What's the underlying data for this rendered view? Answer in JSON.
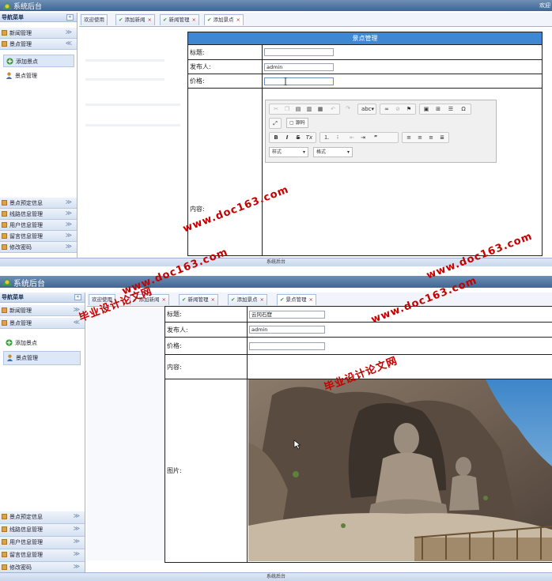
{
  "app": {
    "title": "系统后台",
    "corner_text": "欢迎"
  },
  "sidebar": {
    "header": "导航菜单",
    "collapse_glyph": "«",
    "expand_glyph": "»",
    "top_groups": [
      {
        "label": "新闻管理"
      },
      {
        "label": "景点管理"
      }
    ],
    "sub_items": [
      {
        "label": "添加景点"
      },
      {
        "label": "景点管理"
      }
    ],
    "bottom_groups": [
      {
        "label": "景点预定信息"
      },
      {
        "label": "线路信息管理"
      },
      {
        "label": "用户信息管理"
      },
      {
        "label": "留言信息管理"
      },
      {
        "label": "修改密码"
      }
    ]
  },
  "screen1": {
    "tabs": [
      {
        "label": "欢迎使用"
      },
      {
        "label": "添加新闻"
      },
      {
        "label": "新闻管理"
      },
      {
        "label": "添加景点"
      }
    ],
    "form": {
      "heading": "景点管理",
      "title_label": "标题:",
      "publisher_label": "发布人:",
      "publisher_value": "admin",
      "price_label": "价格:",
      "content_label": "内容:"
    },
    "editor": {
      "source_button": "源码",
      "style_combo": "样式",
      "format_combo": "格式"
    },
    "footer": "系统后台"
  },
  "screen2": {
    "tabs": [
      {
        "label": "欢迎使用"
      },
      {
        "label": "添加新闻"
      },
      {
        "label": "新闻管理"
      },
      {
        "label": "添加景点"
      },
      {
        "label": "景点管理"
      }
    ],
    "form": {
      "title_label": "标题:",
      "title_value": "云冈石窟",
      "publisher_label": "发布人:",
      "publisher_value": "admin",
      "price_label": "价格:",
      "content_label": "内容:",
      "image_label": "图片:"
    },
    "footer": "系统后台"
  },
  "watermark": {
    "cn": "毕业设计论文网",
    "url": "www.doc163.com"
  },
  "colors": {
    "header": "#3f6694",
    "form_title": "#3f87d0",
    "watermark": "#c40000"
  }
}
